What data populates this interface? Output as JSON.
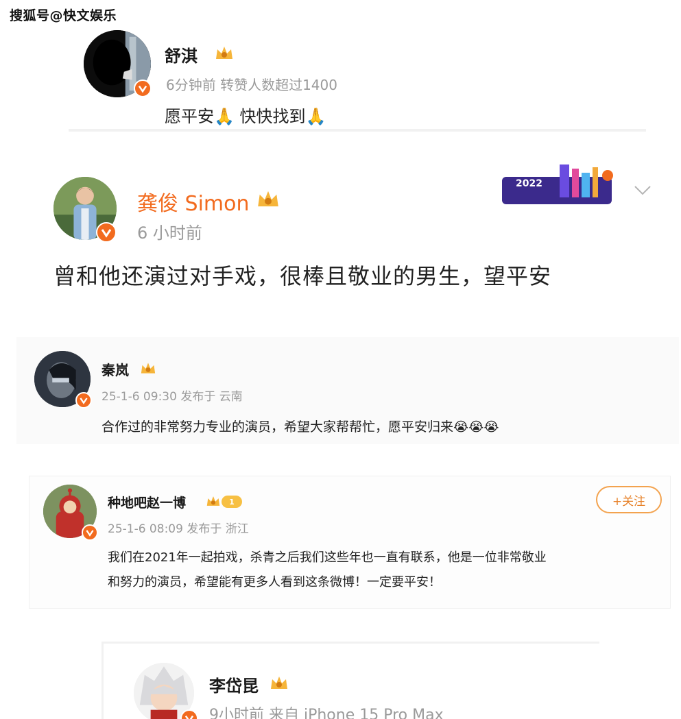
{
  "watermark": "搜狐号@快文娱乐",
  "posts": [
    {
      "name": "舒淇",
      "meta": "6分钟前 转赞人数超过1400",
      "content": "愿平安🙏 快快找到🙏"
    },
    {
      "name": "龚俊 Simon",
      "meta": "6 小时前",
      "content": "曾和他还演过对手戏，很棒且敬业的男生，望平安",
      "banner": "2022"
    },
    {
      "name": "秦岚",
      "meta": "25-1-6 09:30 发布于 云南",
      "content": "合作过的非常努力专业的演员，希望大家帮帮忙，愿平安归来😭😭😭"
    },
    {
      "name": "种地吧赵一博",
      "level": "1",
      "meta": "25-1-6 08:09 发布于 浙江",
      "content_line1": "我们在2021年一起拍戏，杀青之后我们这些年也一直有联系，他是一位非常敬业",
      "content_line2": "和努力的演员，希望能有更多人看到这条微博！一定要平安！",
      "follow_label": "+关注"
    },
    {
      "name": "李岱昆",
      "meta": "9小时前  来自 iPhone 15 Pro Max"
    }
  ],
  "colors": {
    "accent": "#f26b1f",
    "meta": "#9a9a9a",
    "follow": "#e7822a"
  }
}
